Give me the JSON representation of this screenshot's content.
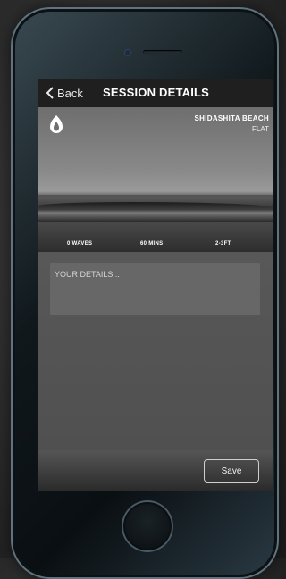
{
  "navbar": {
    "back_label": "Back",
    "title": "SESSION DETAILS"
  },
  "spot": {
    "name": "SHIDASHITA BEACH",
    "conditions": "FLAT"
  },
  "stats": {
    "waves": "0 WAVES",
    "duration": "60 MINS",
    "size": "2-3FT"
  },
  "details": {
    "placeholder": "YOUR DETAILS..."
  },
  "footer": {
    "save_label": "Save"
  },
  "icons": {
    "back": "chevron-left-icon",
    "logo": "brand-logo-icon"
  }
}
